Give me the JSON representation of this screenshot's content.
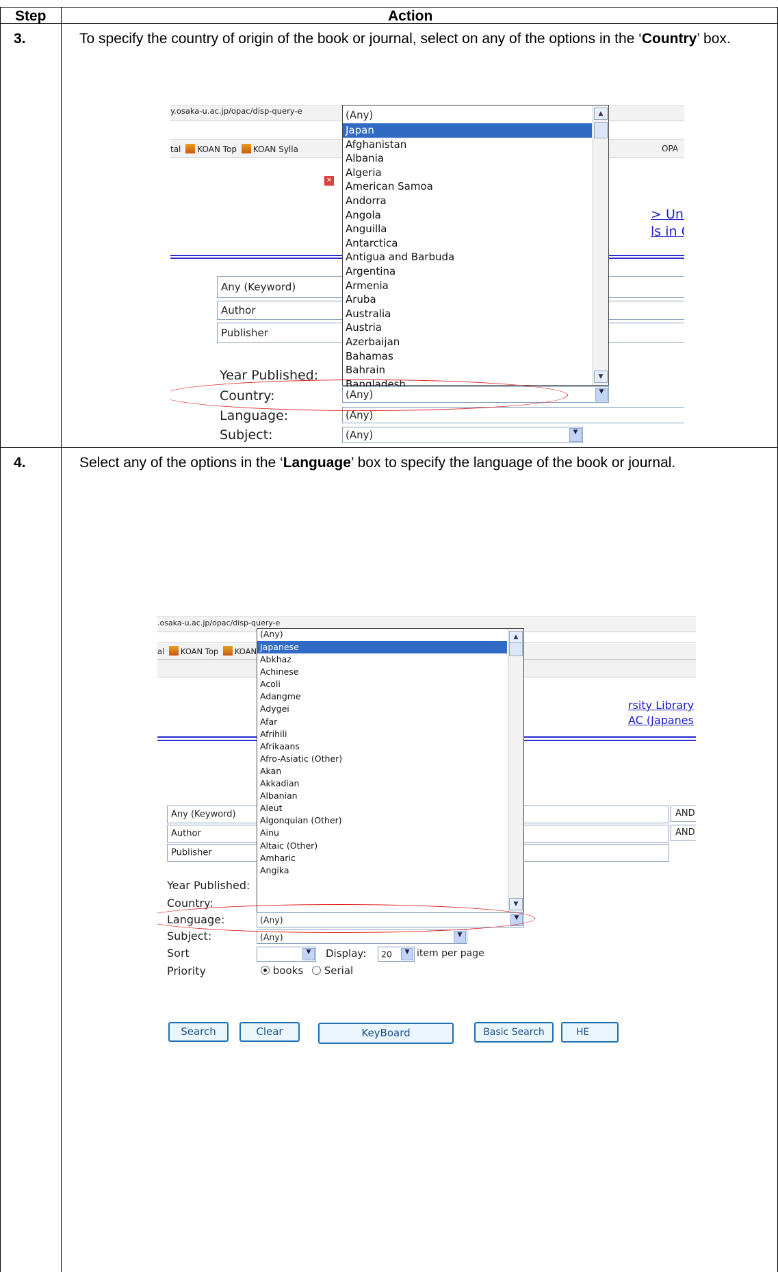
{
  "table": {
    "header_step": "Step",
    "header_action": "Action"
  },
  "steps": [
    {
      "number": "3.",
      "text_pre": "To specify the country of origin of the book or journal, select on any of the options in the ‘",
      "text_bold": "Country",
      "text_post": "’ box."
    },
    {
      "number": "4.",
      "text_pre": "Select any of the options in the ‘",
      "text_bold": "Language",
      "text_post": "’ box to specify the language of the book or journal."
    }
  ],
  "shot1": {
    "url": "y.osaka-u.ac.jp/opac/disp-query-e",
    "bookmarks": [
      "tal",
      "KOAN Top",
      "KOAN Sylla"
    ],
    "bookmark_right": "OPA",
    "link1": "> Uni",
    "link2": "ls in C",
    "fields": [
      "Any (Keyword)",
      "Author",
      "Publisher"
    ],
    "labels": {
      "year": "Year Published:",
      "country": "Country:",
      "language": "Language:",
      "subject": "Subject:"
    },
    "dropdown_head": "(Any)",
    "dropdown_items": [
      "Japan",
      "Afghanistan",
      "Albania",
      "Algeria",
      "American Samoa",
      "Andorra",
      "Angola",
      "Anguilla",
      "Antarctica",
      "Antigua and Barbuda",
      "Argentina",
      "Armenia",
      "Aruba",
      "Australia",
      "Austria",
      "Azerbaijan",
      "Bahamas",
      "Bahrain",
      "Bangladesh"
    ],
    "selected_item": "Japan",
    "country_value": "(Any)",
    "language_value": "(Any)",
    "subject_value": "(Any)"
  },
  "shot2": {
    "url": ".osaka-u.ac.jp/opac/disp-query-e",
    "bookmarks": [
      "al",
      "KOAN Top",
      "KOAN Sylla"
    ],
    "link1": "rsity Library",
    "link2": "AC (Japanes",
    "fields": [
      "Any (Keyword)",
      "Author",
      "Publisher"
    ],
    "and_labels": [
      "AND",
      "AND"
    ],
    "labels": {
      "year": "Year Published:",
      "country": "Country:",
      "language": "Language:",
      "subject": "Subject:",
      "sort": "Sort",
      "priority": "Priority",
      "display": "Display:",
      "per_page": "item per page"
    },
    "dropdown_head": "(Any)",
    "dropdown_items": [
      "Japanese",
      "Abkhaz",
      "Achinese",
      "Acoli",
      "Adangme",
      "Adygei",
      "Afar",
      "Afrihili",
      "Afrikaans",
      "Afro-Asiatic (Other)",
      "Akan",
      "Akkadian",
      "Albanian",
      "Aleut",
      "Algonquian (Other)",
      "Ainu",
      "Altaic (Other)",
      "Amharic",
      "Angika"
    ],
    "selected_item": "Japanese",
    "language_value": "(Any)",
    "subject_value": "(Any)",
    "display_value": "20",
    "priority_options": [
      "books",
      "Serial"
    ],
    "buttons": [
      "Search",
      "Clear",
      "KeyBoard",
      "Basic Search",
      "HE"
    ]
  }
}
